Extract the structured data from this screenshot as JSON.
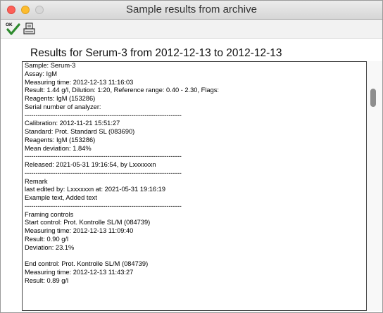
{
  "window": {
    "title": "Sample results from archive"
  },
  "toolbar": {
    "ok_badge": "OK"
  },
  "header": {
    "title": "Results for Serum-3 from 2012-12-13 to 2012-12-13"
  },
  "report_lines": [
    "Sample: Serum-3",
    "Assay: IgM",
    "Measuring time: 2012-12-13 11:16:03",
    "Result: 1.44 g/l, Dilution: 1:20, Reference range: 0.40 - 2.30, Flags:",
    "Reagents: IgM (153286)",
    "Serial number of analyzer:",
    "------------------------------------------------------------------------",
    "Calibration: 2012-11-21 15:51:27",
    "Standard: Prot. Standard SL (083690)",
    "Reagents: IgM (153286)",
    "Mean deviation: 1.84%",
    "------------------------------------------------------------------------",
    "Released: 2021-05-31 19:16:54, by Lxxxxxxn",
    "------------------------------------------------------------------------",
    "Remark",
    "last edited by: Lxxxxxxn at: 2021-05-31 19:16:19",
    "Example text, Added text",
    "------------------------------------------------------------------------",
    "Framing controls",
    "Start control: Prot. Kontrolle SL/M (084739)",
    "Measuring time: 2012-12-13 11:09:40",
    "Result: 0.90 g/l",
    "Deviation: 23.1%",
    "",
    "End control: Prot. Kontrolle SL/M (084739)",
    "Measuring time: 2012-12-13 11:43:27",
    "Result: 0.89 g/l"
  ],
  "scroll": {
    "position_fraction": 0.12
  }
}
